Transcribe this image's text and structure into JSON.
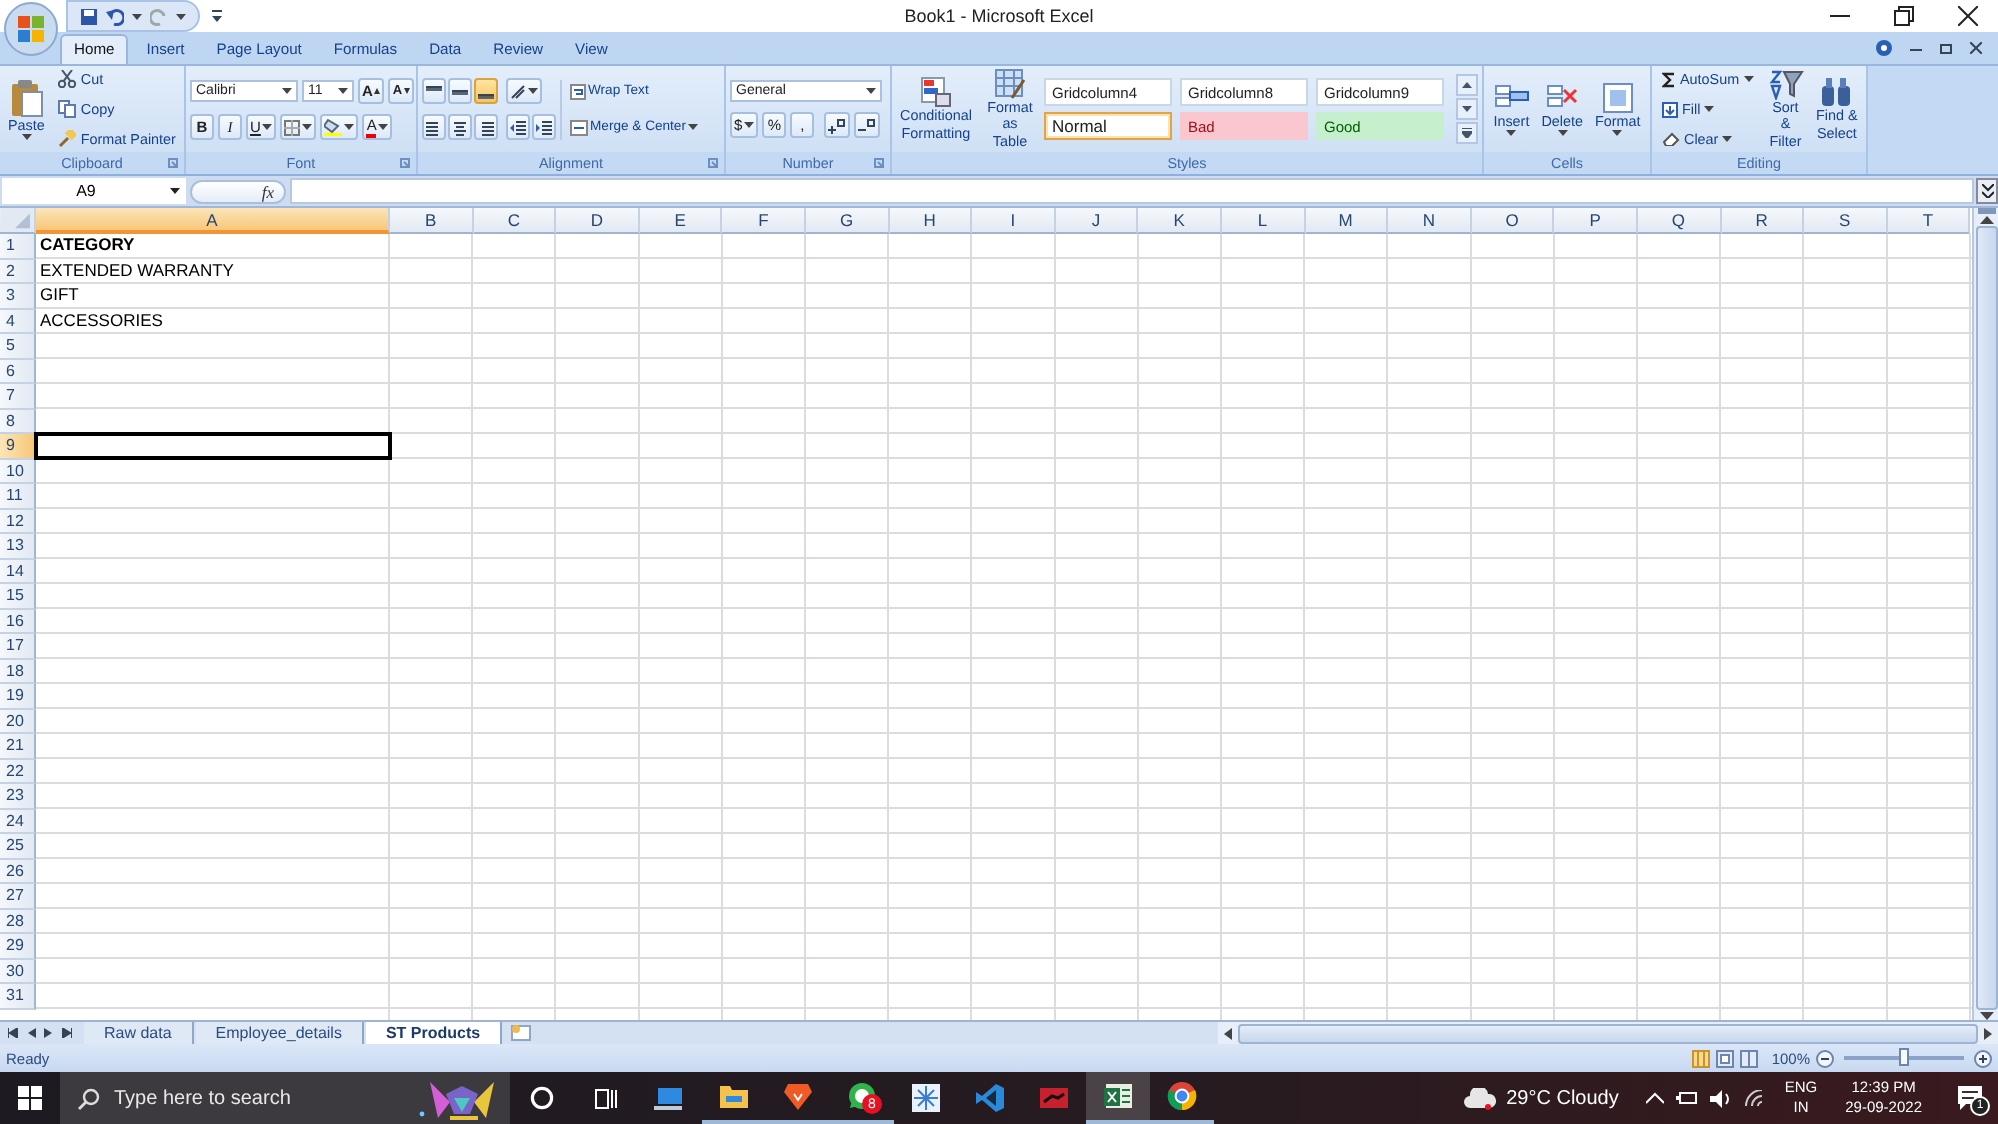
{
  "title_bar": {
    "title": "Book1 - Microsoft Excel"
  },
  "ribbon_tabs": [
    {
      "label": "Home",
      "selected": true
    },
    {
      "label": "Insert",
      "selected": false
    },
    {
      "label": "Page Layout",
      "selected": false
    },
    {
      "label": "Formulas",
      "selected": false
    },
    {
      "label": "Data",
      "selected": false
    },
    {
      "label": "Review",
      "selected": false
    },
    {
      "label": "View",
      "selected": false
    }
  ],
  "clipboard": {
    "paste": "Paste",
    "cut": "Cut",
    "copy": "Copy",
    "format_painter": "Format Painter",
    "label": "Clipboard"
  },
  "font": {
    "name": "Calibri",
    "size": "11",
    "grow": "A",
    "shrink": "A",
    "bold": "B",
    "italic": "I",
    "underline": "U",
    "color_letter": "A",
    "label": "Font"
  },
  "alignment": {
    "vertical_align": [
      {
        "selected": false
      },
      {
        "selected": false
      },
      {
        "selected": true
      }
    ],
    "wrap_text": "Wrap Text",
    "merge_center": "Merge & Center",
    "label": "Alignment"
  },
  "number": {
    "format": "General",
    "currency": "$",
    "percent": "%",
    "comma": ",",
    "label": "Number"
  },
  "styles": {
    "conditional": "Conditional Formatting",
    "format_table": "Format as Table",
    "cells": [
      {
        "label": "Gridcolumn4",
        "kind": "plain",
        "selected": false
      },
      {
        "label": "Gridcolumn8",
        "kind": "plain",
        "selected": false
      },
      {
        "label": "Gridcolumn9",
        "kind": "plain",
        "selected": false
      },
      {
        "label": "Normal",
        "kind": "normal",
        "selected": true
      },
      {
        "label": "Bad",
        "kind": "bad",
        "selected": false
      },
      {
        "label": "Good",
        "kind": "good",
        "selected": false
      }
    ],
    "label": "Styles"
  },
  "cells": {
    "insert": "Insert",
    "delete": "Delete",
    "format": "Format",
    "label": "Cells"
  },
  "editing": {
    "autosum": "AutoSum",
    "fill": "Fill",
    "clear": "Clear",
    "sort_filter": "Sort & Filter",
    "find_select": "Find & Select",
    "label": "Editing"
  },
  "formula_bar": {
    "name_box": "A9",
    "function_label": "fx"
  },
  "sheet": {
    "columns": [
      {
        "label": "A",
        "selected": true
      },
      {
        "label": "B",
        "selected": false
      },
      {
        "label": "C",
        "selected": false
      },
      {
        "label": "D",
        "selected": false
      },
      {
        "label": "E",
        "selected": false
      },
      {
        "label": "F",
        "selected": false
      },
      {
        "label": "G",
        "selected": false
      },
      {
        "label": "H",
        "selected": false
      },
      {
        "label": "I",
        "selected": false
      },
      {
        "label": "J",
        "selected": false
      },
      {
        "label": "K",
        "selected": false
      },
      {
        "label": "L",
        "selected": false
      },
      {
        "label": "M",
        "selected": false
      },
      {
        "label": "N",
        "selected": false
      },
      {
        "label": "O",
        "selected": false
      },
      {
        "label": "P",
        "selected": false
      },
      {
        "label": "Q",
        "selected": false
      },
      {
        "label": "R",
        "selected": false
      },
      {
        "label": "S",
        "selected": false
      },
      {
        "label": "T",
        "selected": false
      }
    ],
    "rows": [
      {
        "number": "1",
        "value": "CATEGORY",
        "bold": true,
        "selected": false
      },
      {
        "number": "2",
        "value": "EXTENDED WARRANTY",
        "bold": false,
        "selected": false
      },
      {
        "number": "3",
        "value": "GIFT",
        "bold": false,
        "selected": false
      },
      {
        "number": "4",
        "value": "ACCESSORIES",
        "bold": false,
        "selected": false
      },
      {
        "number": "5",
        "selected": false
      },
      {
        "number": "6",
        "selected": false
      },
      {
        "number": "7",
        "selected": false
      },
      {
        "number": "8",
        "selected": false
      },
      {
        "number": "9",
        "selected": true
      },
      {
        "number": "10",
        "selected": false
      },
      {
        "number": "11",
        "selected": false
      },
      {
        "number": "12",
        "selected": false
      },
      {
        "number": "13",
        "selected": false
      },
      {
        "number": "14",
        "selected": false
      },
      {
        "number": "15",
        "selected": false
      },
      {
        "number": "16",
        "selected": false
      },
      {
        "number": "17",
        "selected": false
      },
      {
        "number": "18",
        "selected": false
      },
      {
        "number": "19",
        "selected": false
      },
      {
        "number": "20",
        "selected": false
      },
      {
        "number": "21",
        "selected": false
      },
      {
        "number": "22",
        "selected": false
      },
      {
        "number": "23",
        "selected": false
      },
      {
        "number": "24",
        "selected": false
      },
      {
        "number": "25",
        "selected": false
      },
      {
        "number": "26",
        "selected": false
      },
      {
        "number": "27",
        "selected": false
      },
      {
        "number": "28",
        "selected": false
      },
      {
        "number": "29",
        "selected": false
      },
      {
        "number": "30",
        "selected": false
      },
      {
        "number": "31",
        "selected": false
      }
    ]
  },
  "sheet_tabs": [
    {
      "label": "Raw data",
      "selected": false
    },
    {
      "label": "Employee_details",
      "selected": false
    },
    {
      "label": "ST Products",
      "selected": true
    }
  ],
  "status_bar": {
    "status": "Ready",
    "zoom": {
      "reading": "100%",
      "level": 0.5
    }
  },
  "taskbar": {
    "search_placeholder": "Type here to search",
    "apps": [
      {
        "kind": "remote",
        "running": false,
        "active": false
      },
      {
        "kind": "folder",
        "running": true,
        "active": false
      },
      {
        "kind": "brave",
        "running": true,
        "active": false
      },
      {
        "kind": "whatsapp",
        "running": true,
        "active": false,
        "badge": "8"
      },
      {
        "kind": "snowflake",
        "running": false,
        "active": false
      },
      {
        "kind": "vscode",
        "running": false,
        "active": false
      },
      {
        "kind": "terminal",
        "running": false,
        "active": false
      },
      {
        "kind": "excel",
        "running": true,
        "active": true
      },
      {
        "kind": "chrome",
        "running": true,
        "active": false
      }
    ],
    "weather": "29°C Cloudy",
    "language": "ENG",
    "region": "IN",
    "time": "12:39 PM",
    "date": "29-09-2022",
    "notifications": "1"
  }
}
